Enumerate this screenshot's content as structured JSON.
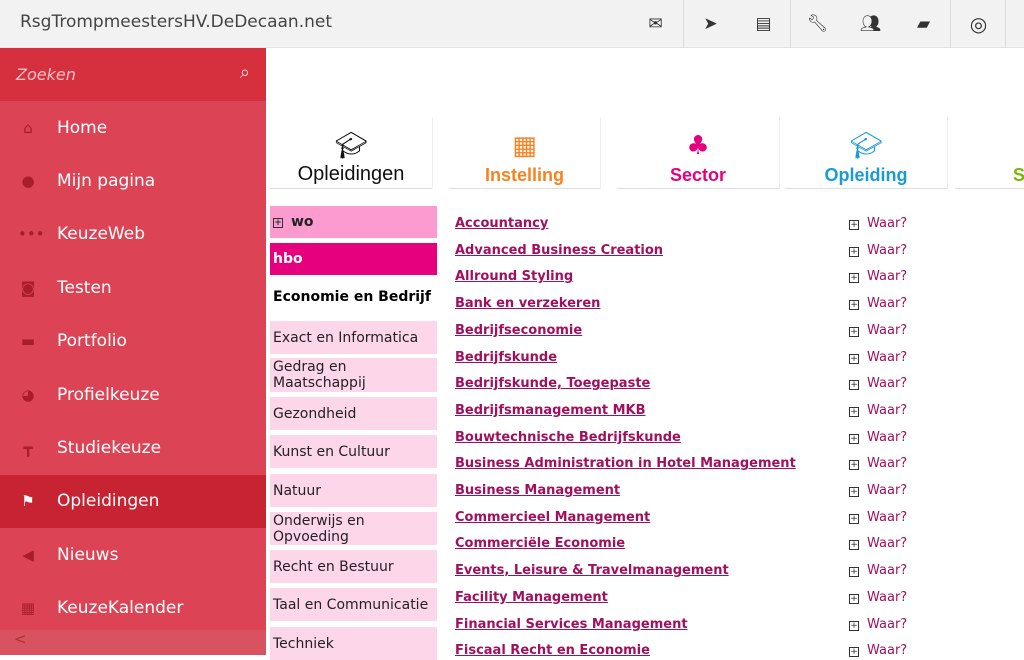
{
  "header": {
    "title": "RsgTrompmeestersHV.DeDecaan.net",
    "icons": [
      "mail-icon",
      "send-icon",
      "list-icon",
      "wrench-icon",
      "users-icon",
      "book-icon",
      "target-icon"
    ]
  },
  "sidebar": {
    "search_placeholder": "Zoeken",
    "items": [
      {
        "label": "Home",
        "icon": "home-icon",
        "glyph": "⌂"
      },
      {
        "label": "Mijn pagina",
        "icon": "user-icon",
        "glyph": "●"
      },
      {
        "label": "KeuzeWeb",
        "icon": "dots-icon",
        "glyph": "•••"
      },
      {
        "label": "Testen",
        "icon": "camera-icon",
        "glyph": "◙"
      },
      {
        "label": "Portfolio",
        "icon": "briefcase-icon",
        "glyph": "▬"
      },
      {
        "label": "Profielkeuze",
        "icon": "pie-icon",
        "glyph": "◕"
      },
      {
        "label": "Studiekeuze",
        "icon": "signpost-icon",
        "glyph": "┳"
      },
      {
        "label": "Opleidingen",
        "icon": "flag-icon",
        "glyph": "⚑",
        "active": true
      },
      {
        "label": "Nieuws",
        "icon": "megaphone-icon",
        "glyph": "◀"
      },
      {
        "label": "KeuzeKalender",
        "icon": "calendar-icon",
        "glyph": "▦"
      }
    ],
    "collapse": "<"
  },
  "tabs": [
    {
      "label": "Opleidingen",
      "color": "#111111",
      "icon": "building-graduation-icon"
    },
    {
      "label": "Instelling",
      "color": "#f7821f",
      "icon": "building-icon"
    },
    {
      "label": "Sector",
      "color": "#e6007e",
      "icon": "sitemap-icon"
    },
    {
      "label": "Opleiding",
      "color": "#1a9ad6",
      "icon": "graduation-cap-icon"
    },
    {
      "label": "S",
      "color": "#7ab800"
    }
  ],
  "levels": {
    "wo": "wo",
    "hbo": "hbo"
  },
  "sectors": [
    "Economie en Bedrijf",
    "Exact en Informatica",
    "Gedrag en Maatschappij",
    "Gezondheid",
    "Kunst en Cultuur",
    "Natuur",
    "Onderwijs en Opvoeding",
    "Recht en Bestuur",
    "Taal en Communicatie",
    "Techniek"
  ],
  "waar_label": "Waar?",
  "programs": [
    "Accountancy",
    "Advanced Business Creation",
    "Allround Styling",
    "Bank en verzekeren",
    "Bedrijfseconomie",
    "Bedrijfskunde",
    "Bedrijfskunde, Toegepaste",
    "Bedrijfsmanagement MKB",
    "Bouwtechnische Bedrijfskunde",
    "Business Administration in Hotel Management",
    "Business Management",
    "Commercieel Management",
    "Commerciële Economie",
    "Events, Leisure & Travelmanagement",
    "Facility Management",
    "Financial Services Management",
    "Fiscaal Recht en Economie"
  ]
}
